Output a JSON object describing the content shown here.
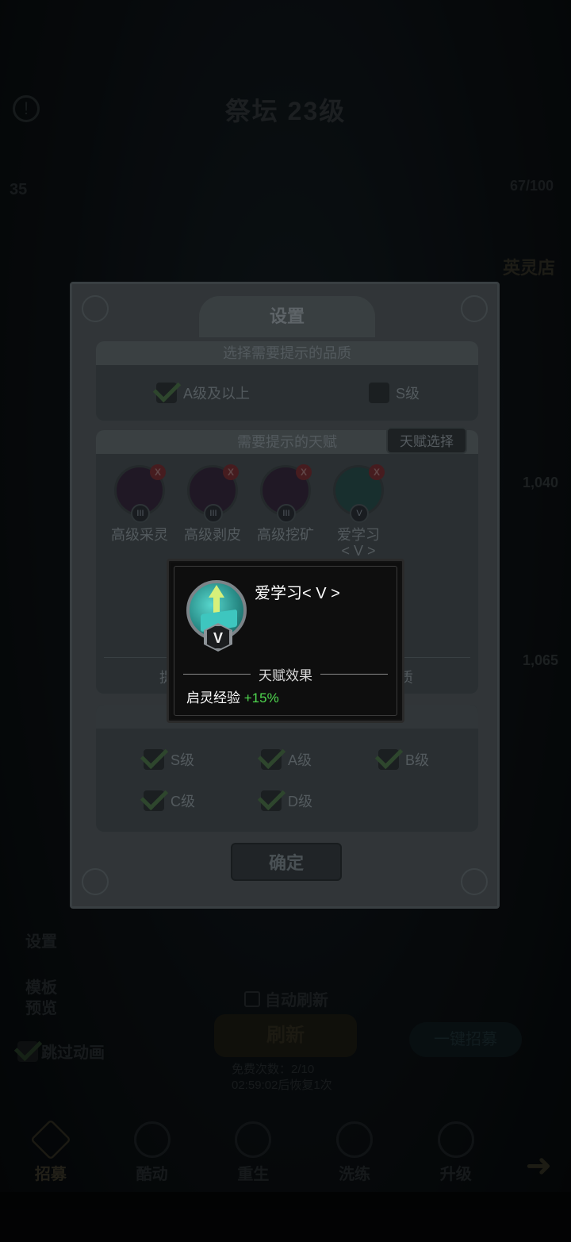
{
  "background": {
    "title": "祭坛 23级",
    "resource_left": "35",
    "resource_right": "67/100",
    "shop_label": "英灵店",
    "side_value_1": "1,040",
    "side_value_2": "1,065",
    "settings_label": "设置",
    "template_label_1": "模板",
    "template_label_2": "预览",
    "skip_animation_label": "跳过动画",
    "auto_refresh_label": "自动刷新",
    "refresh_button": "刷新",
    "one_click_button": "一键招募",
    "free_times": "免费次数：2/10",
    "recover_time": "02:59:02后恢复1次",
    "nav": [
      {
        "label": "招募",
        "active": true
      },
      {
        "label": "酷动",
        "active": false
      },
      {
        "label": "重生",
        "active": false
      },
      {
        "label": "洗练",
        "active": false
      },
      {
        "label": "升级",
        "active": false
      }
    ]
  },
  "settings": {
    "title": "设置",
    "quality_header": "选择需要提示的品质",
    "quality_options": [
      {
        "label": "A级及以上",
        "checked": true
      },
      {
        "label": "S级",
        "checked": false
      }
    ],
    "talent_header": "需要提示的天赋",
    "talent_select_button": "天赋选择",
    "talents": [
      {
        "label": "高级采灵",
        "rank": "III",
        "icon": "pickaxe-icon"
      },
      {
        "label": "高级剥皮",
        "rank": "III",
        "icon": "knife-icon"
      },
      {
        "label": "高级挖矿",
        "rank": "III",
        "icon": "hammer-icon"
      },
      {
        "label": "爱学习\n< V >",
        "rank": "V",
        "icon": "book-icon"
      }
    ],
    "hint_left": "提",
    "hint_right": "质",
    "grade_options": [
      {
        "label": "S级",
        "checked": true
      },
      {
        "label": "A级",
        "checked": true
      },
      {
        "label": "B级",
        "checked": true
      },
      {
        "label": "C级",
        "checked": true
      },
      {
        "label": "D级",
        "checked": true
      }
    ],
    "confirm_button": "确定"
  },
  "popup": {
    "title": "爱学习< V >",
    "rank": "V",
    "effect_header": "天赋效果",
    "effect_label": "启灵经验",
    "effect_value": "+15%"
  }
}
